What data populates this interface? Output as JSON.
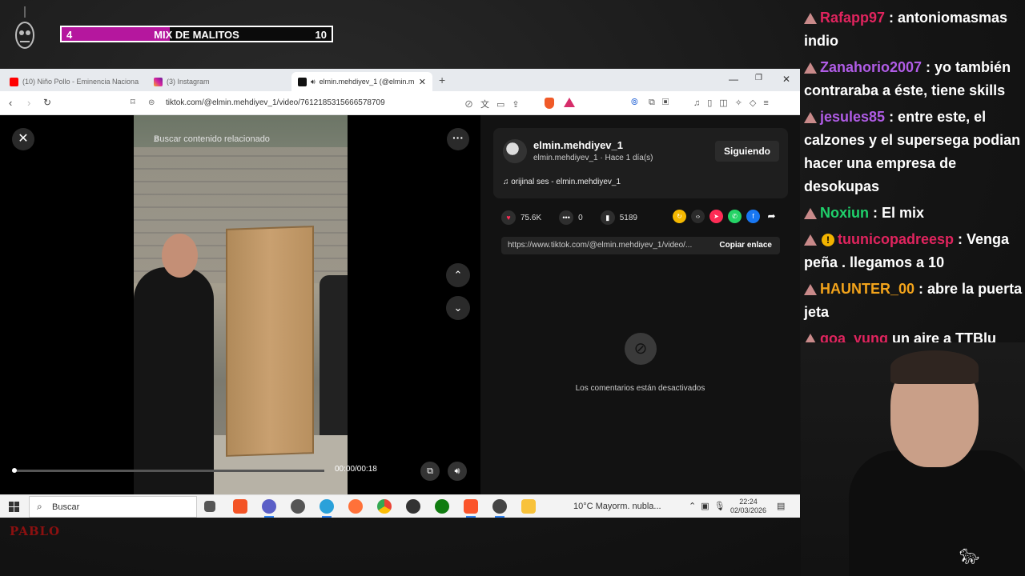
{
  "overlay": {
    "mix_left": "4",
    "mix_title": "MIX DE MALITOS",
    "mix_right": "10",
    "mix_progress": 0.4,
    "bottom_logo": "PABLO"
  },
  "browser": {
    "tabs": [
      {
        "label": "(10) Niño Pollo - Eminencia Naciona",
        "icon_color": "#ff0000"
      },
      {
        "label": "(3) Instagram",
        "icon_color": "#d6249f"
      },
      {
        "label": "elmin.mehdiyev_1 (@elmin.m",
        "icon_color": "#111111"
      }
    ],
    "url": "tiktok.com/@elmin.mehdiyev_1/video/7612185315666578709",
    "search_placeholder": "Buscar contenido relacionado"
  },
  "video": {
    "time": "00:00/00:18",
    "progress": 0.0
  },
  "post": {
    "username": "elmin.mehdiyev_1",
    "subtitle": "elmin.mehdiyev_1 · Hace 1 día(s)",
    "follow_label": "Siguiendo",
    "music": "orijinal ses - elmin.mehdiyev_1",
    "likes": "75.6K",
    "comments": "0",
    "saves": "5189",
    "link": "https://www.tiktok.com/@elmin.mehdiyev_1/video/...",
    "copy_label": "Copiar enlace",
    "comments_disabled": "Los comentarios están desactivados"
  },
  "taskbar": {
    "search_label": "Buscar",
    "weather": "10°C  Mayorm. nubla...",
    "time": "22:24",
    "date": "02/03/2026"
  },
  "chat": [
    {
      "user": "Rafapp97",
      "color": "#e0245e",
      "text": " : antoniomasmas indio",
      "excl": false
    },
    {
      "user": "Zanahorio2007",
      "color": "#b05ce6",
      "text": " : yo también contraraba a éste, tiene skills",
      "excl": false
    },
    {
      "user": "jesules85",
      "color": "#b05ce6",
      "text": " : entre este, el calzones y el supersega podian hacer una empresa de desokupas",
      "excl": false
    },
    {
      "user": "Noxiun",
      "color": "#1fd16b",
      "text": " : El mix",
      "excl": false
    },
    {
      "user": "tuunicopadreesp",
      "color": "#e0245e",
      "text": " : Venga peña . llegamos a 10",
      "excl": true
    },
    {
      "user": "HAUNTER_00",
      "color": "#f2a31b",
      "text": " : abre la puerta jeta",
      "excl": false
    },
    {
      "user": "goa_yung",
      "color": "#e0245e",
      "text": "  un aire a TTBlu",
      "excl": false
    }
  ]
}
